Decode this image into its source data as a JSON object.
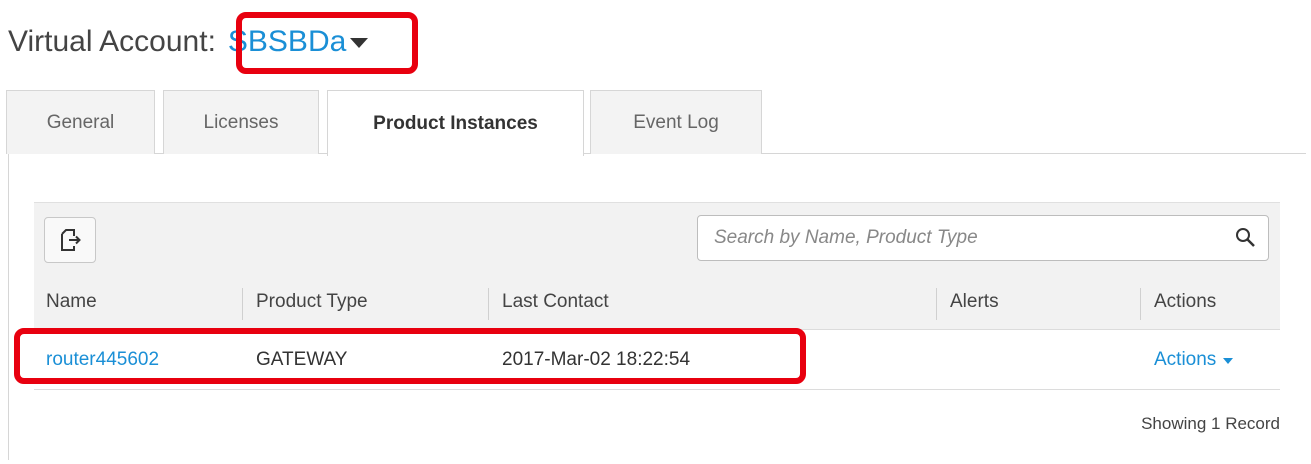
{
  "header": {
    "label": "Virtual Account:",
    "account_name": "SBSBDa"
  },
  "tabs": [
    {
      "label": "General",
      "active": false
    },
    {
      "label": "Licenses",
      "active": false
    },
    {
      "label": "Product Instances",
      "active": true
    },
    {
      "label": "Event Log",
      "active": false
    }
  ],
  "toolbar": {
    "export_icon": "export-icon",
    "search_placeholder": "Search by Name, Product Type",
    "search_value": ""
  },
  "table": {
    "columns": [
      "Name",
      "Product Type",
      "Last Contact",
      "Alerts",
      "Actions"
    ],
    "rows": [
      {
        "name": "router445602",
        "product_type": "GATEWAY",
        "last_contact": "2017-Mar-02 18:22:54",
        "alerts": "",
        "actions_label": "Actions"
      }
    ]
  },
  "footer": {
    "record_count": "Showing 1 Record"
  },
  "colors": {
    "link": "#1a8fd6",
    "highlight": "#e8000f",
    "toolbar_bg": "#f2f2f2"
  }
}
